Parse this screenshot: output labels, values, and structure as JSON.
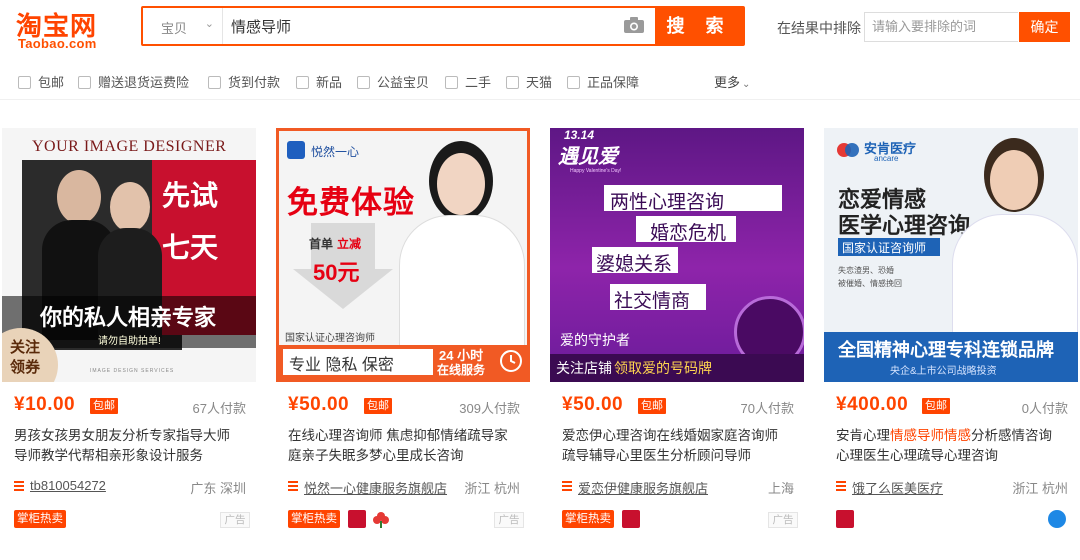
{
  "header": {
    "logo_cn": "淘宝网",
    "logo_en": "Taobao.com",
    "search_category": "宝贝",
    "search_query": "情感导师",
    "search_button": "搜 索",
    "exclude_label": "在结果中排除",
    "exclude_placeholder": "请输入要排除的词",
    "confirm_button": "确定"
  },
  "filters": [
    "包邮",
    "赠送退货运费险",
    "货到付款",
    "新品",
    "公益宝贝",
    "二手",
    "天猫",
    "正品保障"
  ],
  "more_label": "更多",
  "colors": {
    "accent": "#ff5000",
    "price": "#ff4400"
  },
  "cards": [
    {
      "price": "¥10.00",
      "baoyou": "包邮",
      "sales": "67人付款",
      "title_line1": "男孩女孩男女朋友分析专家指导大师",
      "title_line2": "导师教学代帮相亲形象设计服务",
      "shop": "tb810054272",
      "location": "广东 深圳",
      "hot_tag": "掌柜热卖",
      "ad": "广告",
      "img": {
        "header": "YOUR IMAGE DESIGNER",
        "try1": "先试",
        "try2": "七天",
        "main": "你的私人相亲专家",
        "sub": "请勿自助拍单!",
        "follow1": "关注",
        "follow2": "领券",
        "footer": "IMAGE DESIGN SERVICES"
      }
    },
    {
      "price": "¥50.00",
      "baoyou": "包邮",
      "sales": "309人付款",
      "title_line1": "在线心理咨询师 焦虑抑郁情绪疏导家",
      "title_line2": "庭亲子失眠多梦心里成长咨询",
      "shop": "悦然一心健康服务旗舰店",
      "location": "浙江 杭州",
      "hot_tag": "掌柜热卖",
      "ad": "广告",
      "img": {
        "brand": "悦然一心",
        "main": "免费体验",
        "first_a": "首单",
        "first_b": "立减",
        "discount": "50元",
        "cert": "国家认证心理咨询师",
        "bottom": "专业 隐私 保密",
        "hours": "24 小时",
        "online": "在线服务"
      }
    },
    {
      "price": "¥50.00",
      "baoyou": "包邮",
      "sales": "70人付款",
      "title_line1": "爱恋伊心理咨询在线婚姻家庭咨询师",
      "title_line2": "疏导辅导心里医生分析顾问导师",
      "shop": "爱恋伊健康服务旗舰店",
      "location": "上海",
      "hot_tag": "掌柜热卖",
      "ad": "广告",
      "img": {
        "date": "13.14",
        "logo": "遇见爱",
        "valentine": "Happy Valentine's Day!",
        "item1": "两性心理咨询",
        "item2": "婚恋危机",
        "item3": "婆媳关系",
        "item4": "社交情商",
        "guard": "爱的守护者",
        "footer_a": "关注店铺",
        "footer_b": "领取爱的号码牌"
      }
    },
    {
      "price": "¥400.00",
      "baoyou": "包邮",
      "sales": "0人付款",
      "title_pre": "安肯心理",
      "title_hl": "情感导师情感",
      "title_post": "分析感情咨询",
      "title_line2": "心理医生心理疏导心理咨询",
      "shop": "饿了么医美医疗",
      "location": "浙江 杭州",
      "img": {
        "brand_cn": "安肯医疗",
        "brand_en": "ancare",
        "line1": "恋爱情感",
        "line2": "医学心理咨询",
        "cert": "国家认证咨询师",
        "bullet1": "失恋渣男、恐婚",
        "bullet2": "被催婚、情感挽回",
        "banner": "全国精神心理专科连锁品牌",
        "sub_banner": "央企&上市公司战略投资"
      }
    }
  ]
}
